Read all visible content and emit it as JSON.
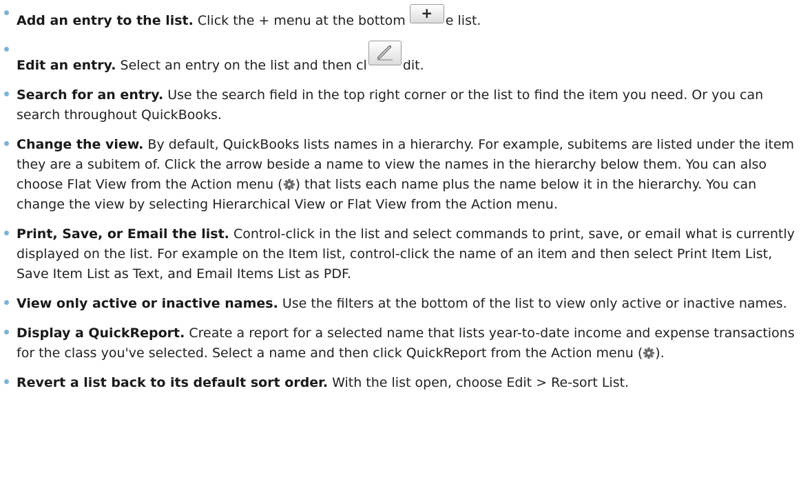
{
  "items": [
    {
      "title": "Add an entry to the list.",
      "text_before": "Click the + menu at the bottom",
      "text_after": "e list.",
      "button_glyph": "+"
    },
    {
      "title": "Edit an entry.",
      "text_before": "Select an entry on the list and then cl",
      "text_after": "dit."
    },
    {
      "title": "Search for an entry.",
      "text": "Use the search field in the top right corner or the list to find the item you need. Or you can search throughout QuickBooks."
    },
    {
      "title": "Change the view.",
      "text_before": "By default, QuickBooks lists names in a hierarchy. For example, subitems are listed under the item they are a subitem of. Click the arrow beside a name to view the names in the hierarchy below them. You can also choose Flat View from the Action menu (",
      "text_after": ") that lists each name plus the name below it in the hierarchy. You can change the view by selecting Hierarchical View or Flat View from the Action menu."
    },
    {
      "title": "Print, Save, or Email the list.",
      "text": "Control-click in the list and select commands to print, save, or email what is currently displayed on the list. For example on the Item list, control-click the name of an item and then select Print Item List, Save Item List as Text, and Email Items List as PDF."
    },
    {
      "title": "View only active or inactive names.",
      "text": "Use the filters at the bottom of the list to view only active or inactive names."
    },
    {
      "title": "Display a QuickReport.",
      "text_before": "Create a report for a selected name that lists year-to-date income and expense transactions for the class you've selected. Select a name and then click QuickReport from the Action menu (",
      "text_after": ")."
    },
    {
      "title": "Revert a list back to its default sort order.",
      "text": "With the list open, choose Edit > Re-sort List."
    }
  ],
  "icons": {
    "plus_button": "plus-icon",
    "edit_button": "pencil-icon",
    "action_menu": "gear-icon"
  },
  "colors": {
    "bullet": "#7ab3d8",
    "text": "#222222"
  }
}
